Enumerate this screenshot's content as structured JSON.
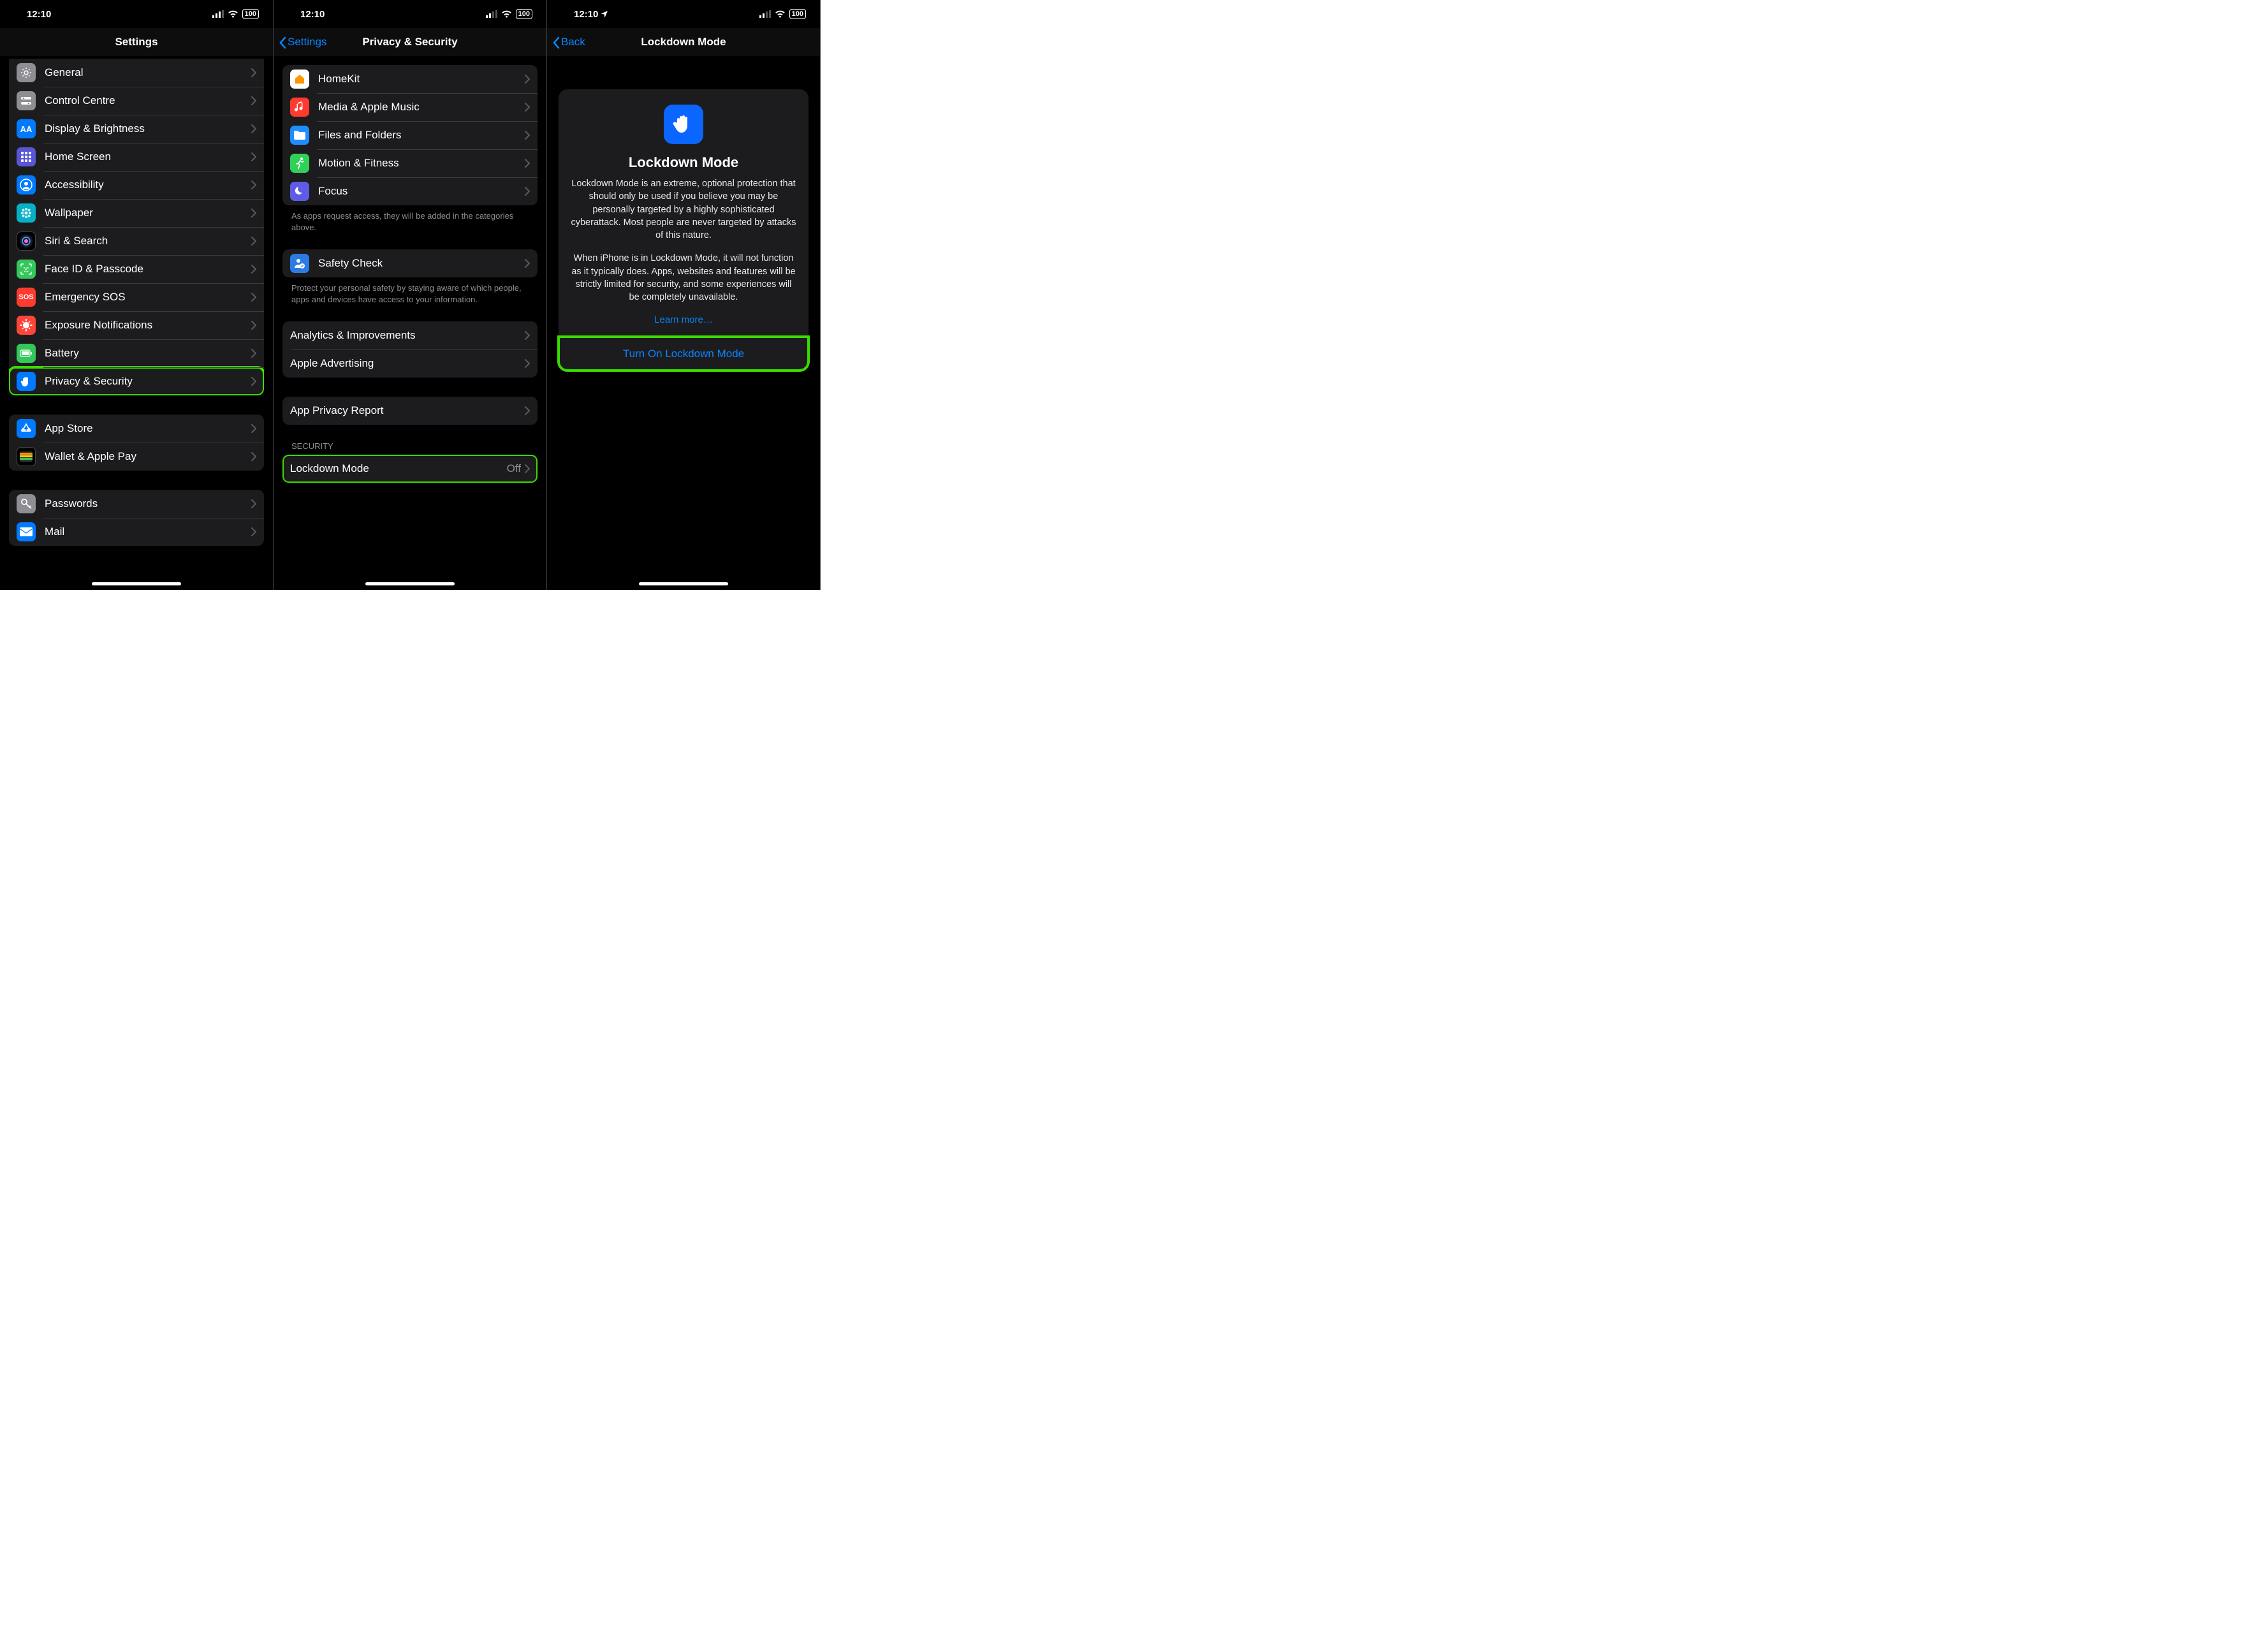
{
  "status": {
    "time": "12:10",
    "battery": "100"
  },
  "screen1": {
    "title": "Settings",
    "group1": [
      {
        "icon": "gear",
        "color": "c-gray",
        "label": "General"
      },
      {
        "icon": "switches",
        "color": "c-gray",
        "label": "Control Centre"
      },
      {
        "icon": "AA",
        "color": "c-blue",
        "label": "Display & Brightness"
      },
      {
        "icon": "grid",
        "color": "c-indigo",
        "label": "Home Screen"
      },
      {
        "icon": "person-circle",
        "color": "c-blue",
        "label": "Accessibility"
      },
      {
        "icon": "flower",
        "color": "c-cyan",
        "label": "Wallpaper"
      },
      {
        "icon": "siri",
        "color": "c-black",
        "label": "Siri & Search"
      },
      {
        "icon": "faceid",
        "color": "c-green",
        "label": "Face ID & Passcode"
      },
      {
        "icon": "SOS",
        "color": "c-red",
        "label": "Emergency SOS"
      },
      {
        "icon": "virus",
        "color": "c-redish",
        "label": "Exposure Notifications"
      },
      {
        "icon": "battery",
        "color": "c-green",
        "label": "Battery"
      },
      {
        "icon": "hand",
        "color": "c-blue",
        "label": "Privacy & Security",
        "highlight": true
      }
    ],
    "group2": [
      {
        "icon": "appstore",
        "color": "c-blue",
        "label": "App Store"
      },
      {
        "icon": "wallet",
        "color": "c-black",
        "label": "Wallet & Apple Pay"
      }
    ],
    "group3": [
      {
        "icon": "key",
        "color": "c-gray",
        "label": "Passwords"
      },
      {
        "icon": "mail",
        "color": "c-blue",
        "label": "Mail"
      }
    ]
  },
  "screen2": {
    "back": "Settings",
    "title": "Privacy & Security",
    "group1": [
      {
        "icon": "home",
        "color": "c-white",
        "label": "HomeKit"
      },
      {
        "icon": "music",
        "color": "c-red",
        "label": "Media & Apple Music"
      },
      {
        "icon": "folder",
        "color": "c-bluefolder",
        "label": "Files and Folders"
      },
      {
        "icon": "runner",
        "color": "c-lime",
        "label": "Motion & Fitness"
      },
      {
        "icon": "moon",
        "color": "c-purple",
        "label": "Focus"
      }
    ],
    "footer1": "As apps request access, they will be added in the categories above.",
    "group2": [
      {
        "icon": "person-check",
        "color": "c-pers",
        "label": "Safety Check"
      }
    ],
    "footer2": "Protect your personal safety by staying aware of which people, apps and devices have access to your information.",
    "group3": [
      {
        "label": "Analytics & Improvements"
      },
      {
        "label": "Apple Advertising"
      }
    ],
    "group4": [
      {
        "label": "App Privacy Report"
      }
    ],
    "sectionHeader": "Security",
    "group5": [
      {
        "label": "Lockdown Mode",
        "detail": "Off",
        "highlight": true
      }
    ]
  },
  "screen3": {
    "back": "Back",
    "title": "Lockdown Mode",
    "cardTitle": "Lockdown Mode",
    "para1": "Lockdown Mode is an extreme, optional protection that should only be used if you believe you may be personally targeted by a highly sophisticated cyberattack. Most people are never targeted by attacks of this nature.",
    "para2": "When iPhone is in Lockdown Mode, it will not function as it typically does. Apps, websites and features will be strictly limited for security, and some experiences will be completely unavailable.",
    "learnMore": "Learn more…",
    "turnOn": "Turn On Lockdown Mode"
  }
}
